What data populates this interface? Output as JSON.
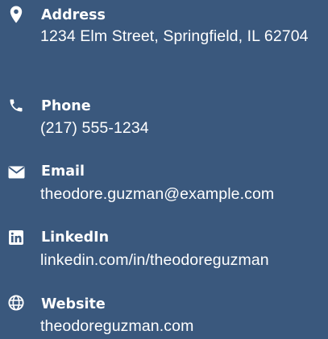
{
  "contact": {
    "background_color": "#3a587d",
    "text_color": "#ffffff",
    "items": [
      {
        "icon": "map-marker-icon",
        "label": "Address",
        "value": "1234 Elm Street, Springfield, IL 62704"
      },
      {
        "icon": "phone-icon",
        "label": "Phone",
        "value": "(217) 555-1234"
      },
      {
        "icon": "envelope-icon",
        "label": "Email",
        "value": "theodore.guzman@example.com"
      },
      {
        "icon": "linkedin-icon",
        "label": "LinkedIn",
        "value": "linkedin.com/in/theodoreguzman"
      },
      {
        "icon": "globe-icon",
        "label": "Website",
        "value": "theodoreguzman.com"
      }
    ]
  }
}
